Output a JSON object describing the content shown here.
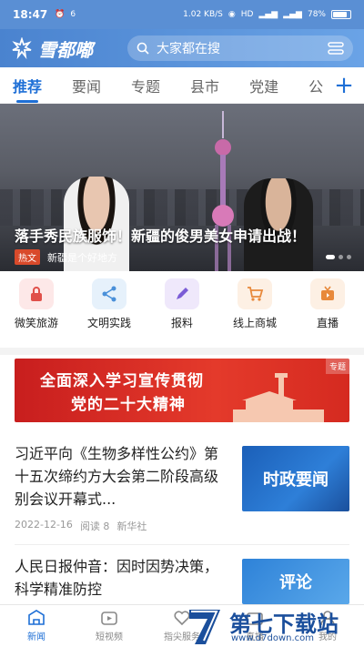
{
  "status_bar": {
    "time": "18:47",
    "speed": "1.02 KB/S",
    "network": "HD",
    "battery": "78%"
  },
  "header": {
    "logo_text": "雪都嘟",
    "search_placeholder": "大家都在搜"
  },
  "tabs": [
    "推荐",
    "要闻",
    "专题",
    "县市",
    "党建",
    "公"
  ],
  "banner": {
    "title": "落手秀民族服饰！新疆的俊男美女申请出战！",
    "tag": "热文",
    "subtitle": "新疆是个好地方",
    "slide_index": 0,
    "slide_count": 3
  },
  "shortcuts": [
    {
      "label": "微笑旅游",
      "icon": "lock-icon",
      "bg": "#fde8e8",
      "color": "#e0504a"
    },
    {
      "label": "文明实践",
      "icon": "share-icon",
      "bg": "#e6f1fb",
      "color": "#4a90d9"
    },
    {
      "label": "报料",
      "icon": "pencil-icon",
      "bg": "#efe8fb",
      "color": "#7b5cd6"
    },
    {
      "label": "线上商城",
      "icon": "cart-icon",
      "bg": "#fdf0e4",
      "color": "#e8893b"
    },
    {
      "label": "直播",
      "icon": "tv-icon",
      "bg": "#fdf0e4",
      "color": "#e8893b"
    }
  ],
  "promo": {
    "line1": "全面深入学习宣传贯彻",
    "line2": "党的二十大精神",
    "tag": "专题"
  },
  "news": [
    {
      "title": "习近平向《生物多样性公约》第十五次缔约方大会第二阶段高级别会议开幕式...",
      "date": "2022-12-16",
      "reads": "阅读 8",
      "source": "新华社",
      "thumb_text": "时政要闻"
    },
    {
      "title": "人民日报仲音：因时因势决策，科学精准防控",
      "date": "",
      "reads": "",
      "source": "",
      "thumb_text": "评论"
    }
  ],
  "bottom_nav": [
    {
      "label": "新闻",
      "icon": "news-icon",
      "active": true
    },
    {
      "label": "短视频",
      "icon": "video-icon",
      "active": false
    },
    {
      "label": "指尖服务",
      "icon": "heart-icon",
      "active": false
    },
    {
      "label": "直播",
      "icon": "live-icon",
      "active": false
    },
    {
      "label": "我的",
      "icon": "user-icon",
      "active": false
    }
  ],
  "watermark": {
    "text": "第七下载站",
    "url": "www.d7down.com"
  },
  "colors": {
    "accent": "#1e6fd6",
    "header": "#5a8fd4",
    "promo_red": "#d52a20",
    "hot_tag": "#d94a2b"
  }
}
